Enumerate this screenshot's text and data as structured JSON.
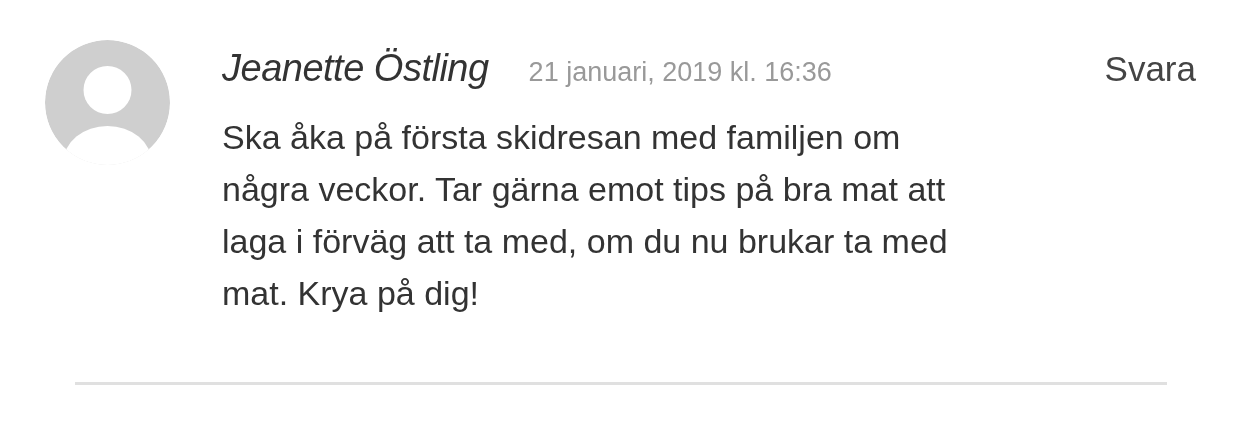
{
  "comment": {
    "author": "Jeanette Östling",
    "date": "21 januari, 2019 kl. 16:36",
    "reply": "Svara",
    "body_lines": [
      "Ska åka på första skidresan med familjen om",
      "några veckor. Tar gärna emot tips på bra mat att",
      "laga i förväg att ta med, om du nu brukar ta med",
      "mat. Krya på dig!"
    ]
  }
}
